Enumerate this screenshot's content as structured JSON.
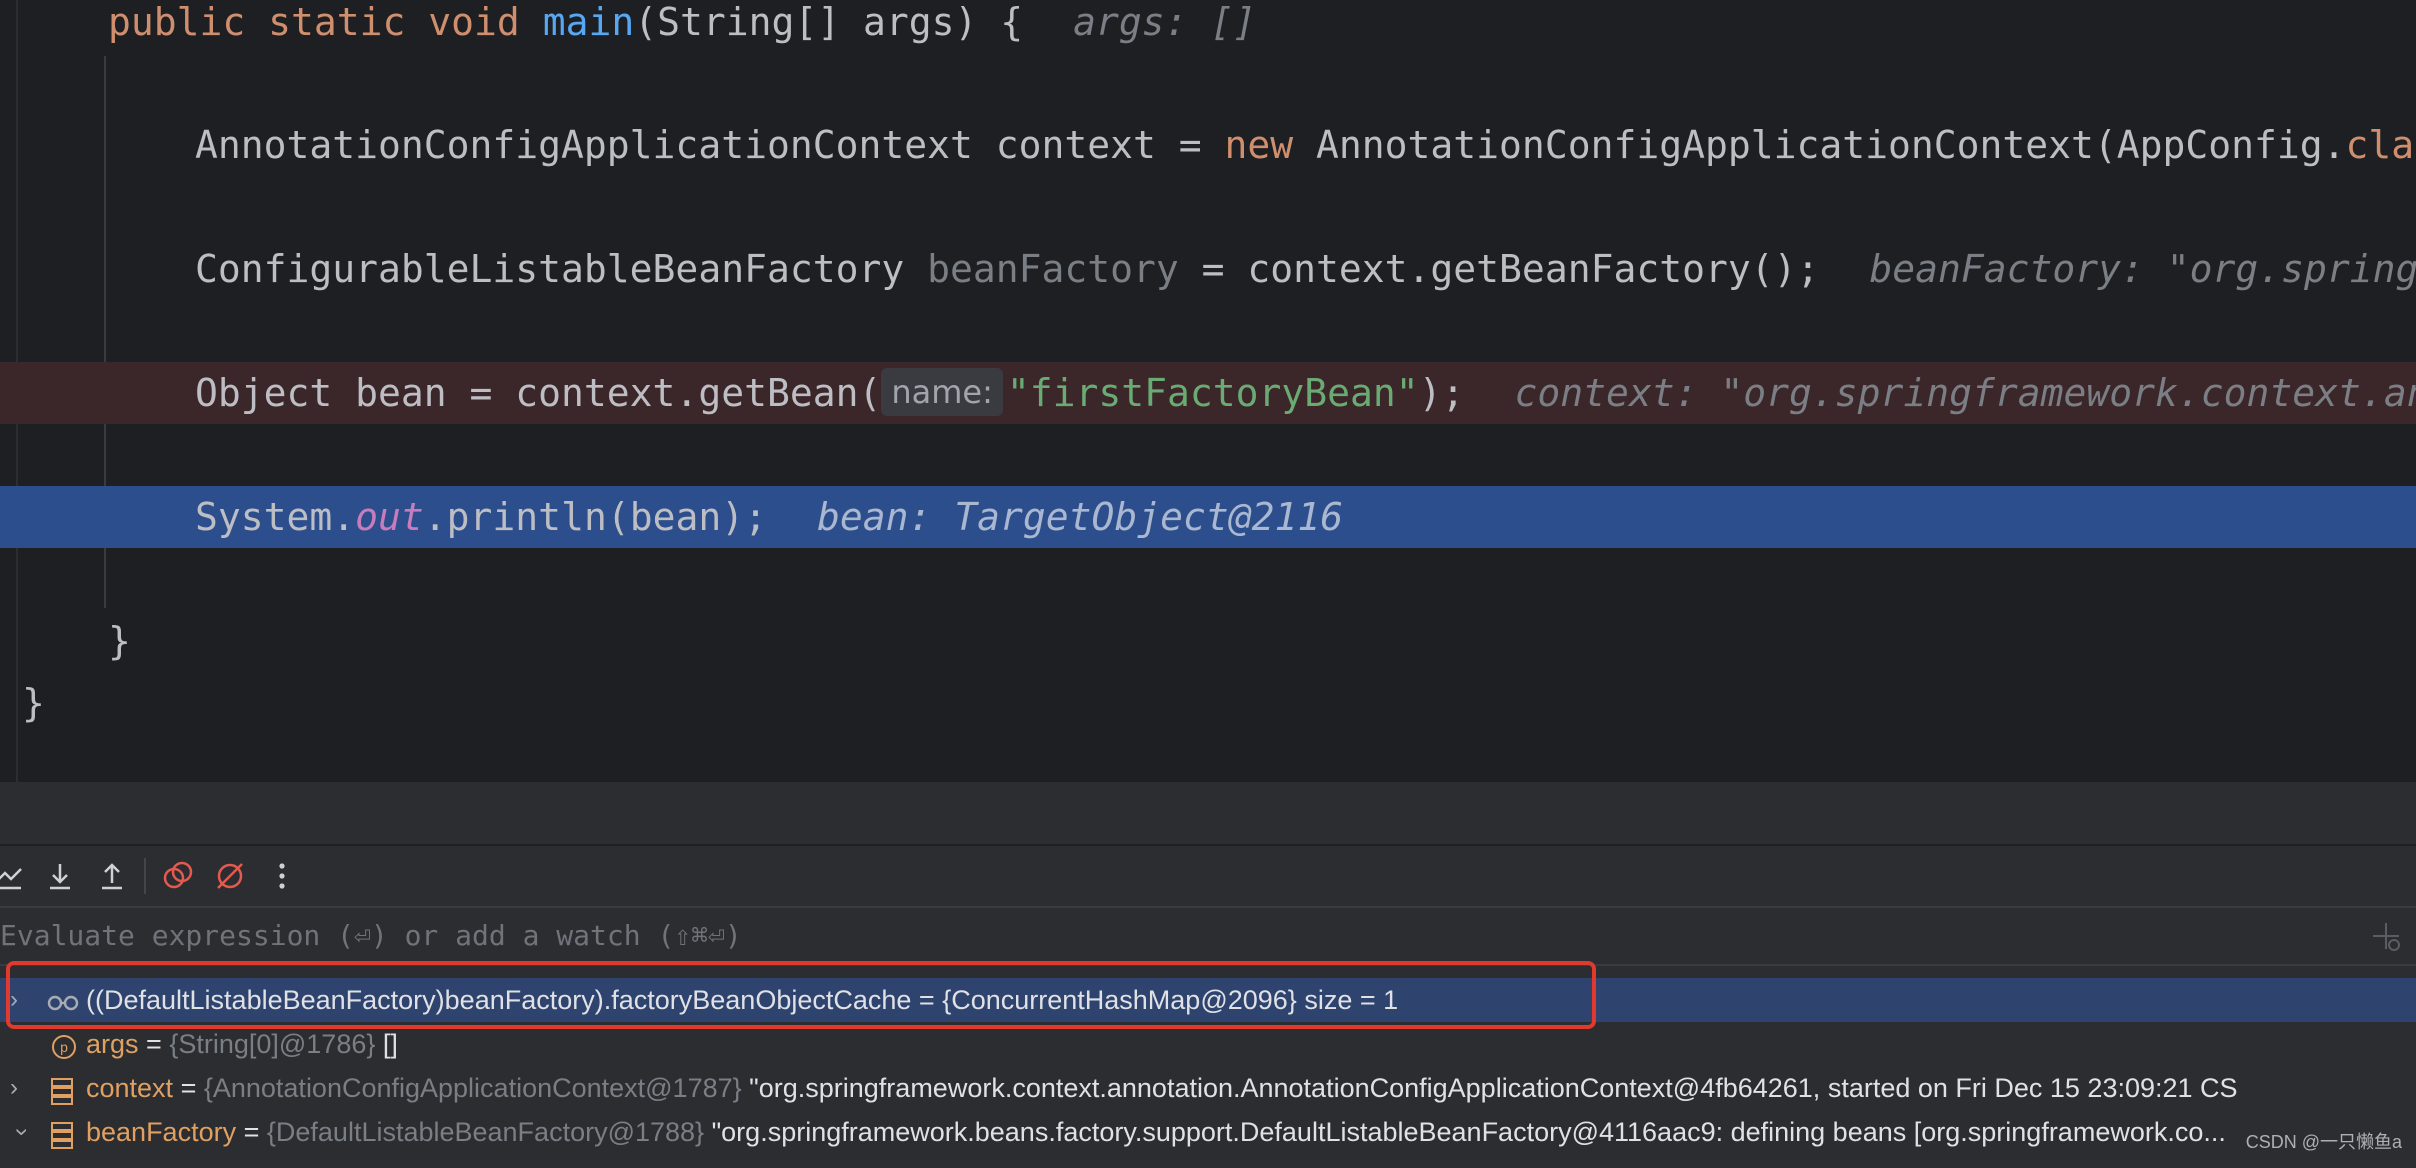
{
  "editor": {
    "line1": {
      "kw1": "public static void ",
      "fn": "main",
      "rest": "(String[] args) {",
      "hint": "args: []"
    },
    "line2": {
      "a": "AnnotationConfigApplicationContext context = ",
      "kw": "new",
      "b": " AnnotationConfigApplicationContext(AppConfig.",
      "kw2": "class",
      "c": ");"
    },
    "line3": {
      "a": "ConfigurableListableBeanFactory ",
      "unused": "beanFactory",
      "b": " = context.getBeanFactory();",
      "hint": "beanFactory: \"org.springframew"
    },
    "line4": {
      "a": "Object bean = context.getBean(",
      "param": "name:",
      "str": "\"firstFactoryBean\"",
      "b": ");",
      "hint": "context: \"org.springframework.context.annotat"
    },
    "line5": {
      "a": "System.",
      "field": "out",
      "b": ".println(bean);",
      "hint": "bean: TargetObject@2116"
    },
    "line6": "}",
    "line7": "}"
  },
  "toolbar": {
    "icons": [
      "run-to-cursor-icon",
      "step-into-icon",
      "step-out-icon",
      "view-breakpoints-icon",
      "mute-breakpoints-icon",
      "more-icon"
    ]
  },
  "evaluate": {
    "placeholder": "Evaluate expression (⏎) or add a watch (⇧⌘⏎)"
  },
  "variables": [
    {
      "name": "((DefaultListableBeanFactory)beanFactory).factoryBeanObjectCache",
      "eq": " = ",
      "type": "",
      "value": "{ConcurrentHashMap@2096}  size = 1"
    },
    {
      "name": "args",
      "eq": " = ",
      "type": "{String[0]@1786}",
      "value": " []"
    },
    {
      "name": "context",
      "eq": " = ",
      "type": "{AnnotationConfigApplicationContext@1787}",
      "value": " \"org.springframework.context.annotation.AnnotationConfigApplicationContext@4fb64261, started on Fri Dec 15 23:09:21 CS"
    },
    {
      "name": "beanFactory",
      "eq": " = ",
      "type": "{DefaultListableBeanFactory@1788}",
      "value": " \"org.springframework.beans.factory.support.DefaultListableBeanFactory@4116aac9: defining beans [org.springframework.co..."
    }
  ],
  "watermark": "CSDN @一只懒鱼a",
  "colors": {
    "breakpoint_line": "#3b2629",
    "current_line": "#2d4e8c",
    "selection": "#2e436e",
    "highlight_box": "#e0392e"
  }
}
